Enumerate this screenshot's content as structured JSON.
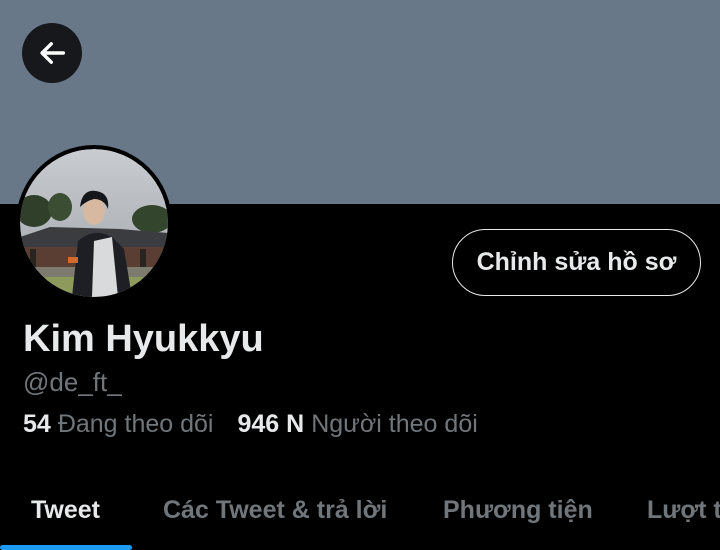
{
  "profile": {
    "display_name": "Kim Hyukkyu",
    "handle": "@de_ft_",
    "edit_button_label": "Chỉnh sửa hồ sơ"
  },
  "stats": {
    "following_count": "54",
    "following_label": "Đang theo dõi",
    "followers_count": "946 N",
    "followers_label": "Người theo dõi"
  },
  "tabs": [
    {
      "label": "Tweet",
      "active": true
    },
    {
      "label": "Các Tweet & trả lời",
      "active": false
    },
    {
      "label": "Phương tiện",
      "active": false
    },
    {
      "label": "Lượt thích",
      "active": false
    }
  ],
  "icons": {
    "back": "arrow-left-icon"
  },
  "colors": {
    "banner": "#687889",
    "background": "#000000",
    "primary_text": "#e7e9ea",
    "secondary_text": "#71767b",
    "accent": "#1d9bf0"
  }
}
